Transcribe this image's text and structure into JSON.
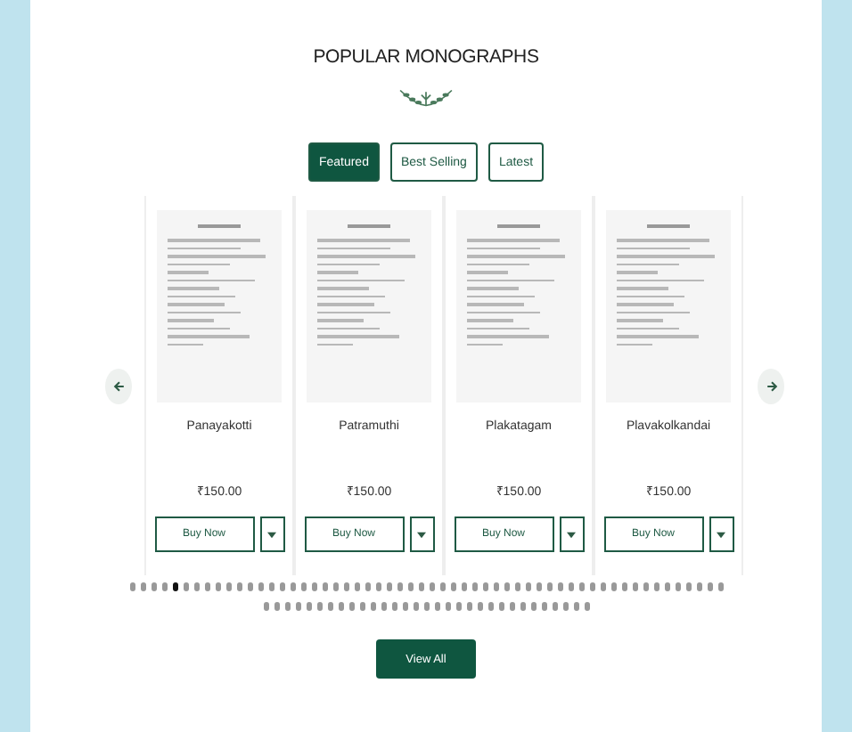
{
  "title": "POPULAR MONOGRAPHS",
  "tabs": [
    {
      "label": "Featured",
      "selected": true
    },
    {
      "label": "Best Selling",
      "selected": false
    },
    {
      "label": "Latest",
      "selected": false
    }
  ],
  "products": [
    {
      "name": "Panayakotti",
      "price": "₹150.00",
      "button": "Buy Now"
    },
    {
      "name": "Patramuthi",
      "price": "₹150.00",
      "button": "Buy Now"
    },
    {
      "name": "Plakatagam",
      "price": "₹150.00",
      "button": "Buy Now"
    },
    {
      "name": "Plavakolkandai",
      "price": "₹150.00",
      "button": "Buy Now"
    }
  ],
  "dots": [
    {
      "selected": false
    },
    {
      "selected": false
    },
    {
      "selected": false
    },
    {
      "selected": false
    },
    {
      "selected": true
    },
    {
      "selected": false
    },
    {
      "selected": false
    },
    {
      "selected": false
    },
    {
      "selected": false
    },
    {
      "selected": false
    },
    {
      "selected": false
    },
    {
      "selected": false
    },
    {
      "selected": false
    },
    {
      "selected": false
    },
    {
      "selected": false
    },
    {
      "selected": false
    },
    {
      "selected": false
    },
    {
      "selected": false
    },
    {
      "selected": false
    },
    {
      "selected": false
    },
    {
      "selected": false
    },
    {
      "selected": false
    },
    {
      "selected": false
    },
    {
      "selected": false
    },
    {
      "selected": false
    },
    {
      "selected": false
    },
    {
      "selected": false
    },
    {
      "selected": false
    },
    {
      "selected": false
    },
    {
      "selected": false
    },
    {
      "selected": false
    },
    {
      "selected": false
    },
    {
      "selected": false
    },
    {
      "selected": false
    },
    {
      "selected": false
    },
    {
      "selected": false
    },
    {
      "selected": false
    },
    {
      "selected": false
    },
    {
      "selected": false
    },
    {
      "selected": false
    },
    {
      "selected": false
    },
    {
      "selected": false
    },
    {
      "selected": false
    },
    {
      "selected": false
    },
    {
      "selected": false
    },
    {
      "selected": false
    },
    {
      "selected": false
    },
    {
      "selected": false
    },
    {
      "selected": false
    },
    {
      "selected": false
    },
    {
      "selected": false
    },
    {
      "selected": false
    },
    {
      "selected": false
    },
    {
      "selected": false
    },
    {
      "selected": false
    },
    {
      "selected": false
    },
    {
      "selected": false
    },
    {
      "selected": false
    },
    {
      "selected": false
    },
    {
      "selected": false
    },
    {
      "selected": false
    },
    {
      "selected": false
    },
    {
      "selected": false
    },
    {
      "selected": false
    },
    {
      "selected": false
    },
    {
      "selected": false
    },
    {
      "selected": false
    },
    {
      "selected": false
    },
    {
      "selected": false
    },
    {
      "selected": false
    },
    {
      "selected": false
    },
    {
      "selected": false
    },
    {
      "selected": false
    },
    {
      "selected": false
    },
    {
      "selected": false
    },
    {
      "selected": false
    },
    {
      "selected": false
    },
    {
      "selected": false
    },
    {
      "selected": false
    },
    {
      "selected": false
    },
    {
      "selected": false
    },
    {
      "selected": false
    },
    {
      "selected": false
    },
    {
      "selected": false
    },
    {
      "selected": false
    },
    {
      "selected": false
    },
    {
      "selected": false
    }
  ],
  "view_all": "View All"
}
